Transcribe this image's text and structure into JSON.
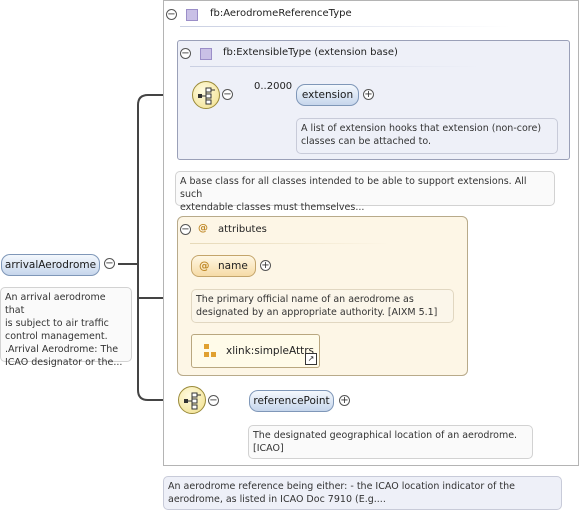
{
  "root": {
    "name": "arrivalAerodrome",
    "doc": [
      "An arrival aerodrome that",
      "is subject to air traffic",
      "control management.",
      ".Arrival Aerodrome: The",
      "ICAO designator or the..."
    ]
  },
  "type": {
    "name": "fb:AerodromeReferenceType",
    "doc": [
      "An aerodrome reference being either: - the ICAO location indicator of the",
      "aerodrome, as listed in ICAO Doc 7910 (E.g...."
    ]
  },
  "base": {
    "name": "fb:ExtensibleType (extension base)",
    "doc": [
      "A base class for all classes intended to be able to support extensions. All such",
      "extendable classes must themselves..."
    ]
  },
  "extension": {
    "name": "extension",
    "cardinality": "0..2000",
    "doc": [
      "A list of extension hooks that extension (non-core)",
      "classes can be attached to."
    ]
  },
  "attributes": {
    "title": "attributes",
    "at_symbol": "@",
    "name_attr": "name",
    "name_doc": [
      "The primary official name of an aerodrome as",
      "designated by an appropriate authority. [AIXM 5.1]"
    ],
    "group": "xlink:simpleAttrs"
  },
  "referencePoint": {
    "name": "referencePoint",
    "doc": [
      "The designated geographical location of an aerodrome.",
      "[ICAO]"
    ]
  },
  "symbols": {
    "collapse": "⊖",
    "expand": "⊕",
    "minus": "−",
    "plus": "+"
  },
  "colors": {
    "element": "#c6d6ec",
    "attribute": "#f6dba6",
    "type_icon": "#c9c0e6",
    "sequence": "#f1df8a"
  }
}
